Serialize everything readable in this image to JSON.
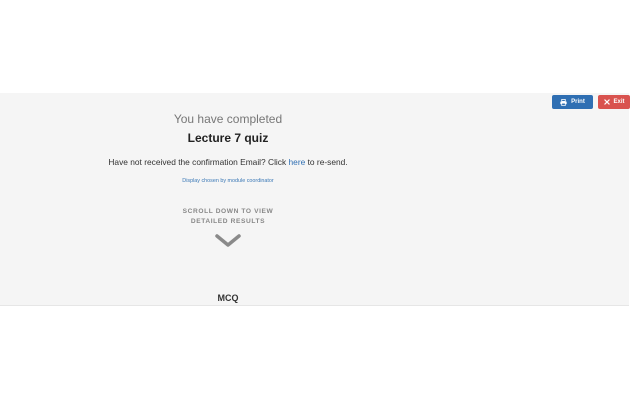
{
  "toolbar": {
    "print_label": "Print",
    "exit_label": "Exit"
  },
  "result": {
    "completed_label": "You have completed",
    "quiz_title": "Lecture 7 quiz",
    "confirm_prefix": "Have not received the confirmation Email? Click ",
    "confirm_link": "here",
    "confirm_suffix": " to re-send.",
    "display_note": "Display chosen by module coordinator",
    "scroll_hint_line1": "SCROLL DOWN TO VIEW",
    "scroll_hint_line2": "DETAILED RESULTS"
  },
  "sections": {
    "first_section_title": "MCQ"
  },
  "colors": {
    "print_button": "#2f6fb3",
    "exit_button": "#d9534f",
    "link": "#2f6fb3",
    "panel_background": "#f5f5f5"
  },
  "icons": {
    "print": "printer-icon",
    "exit": "close-icon",
    "scroll": "chevron-down-icon"
  }
}
